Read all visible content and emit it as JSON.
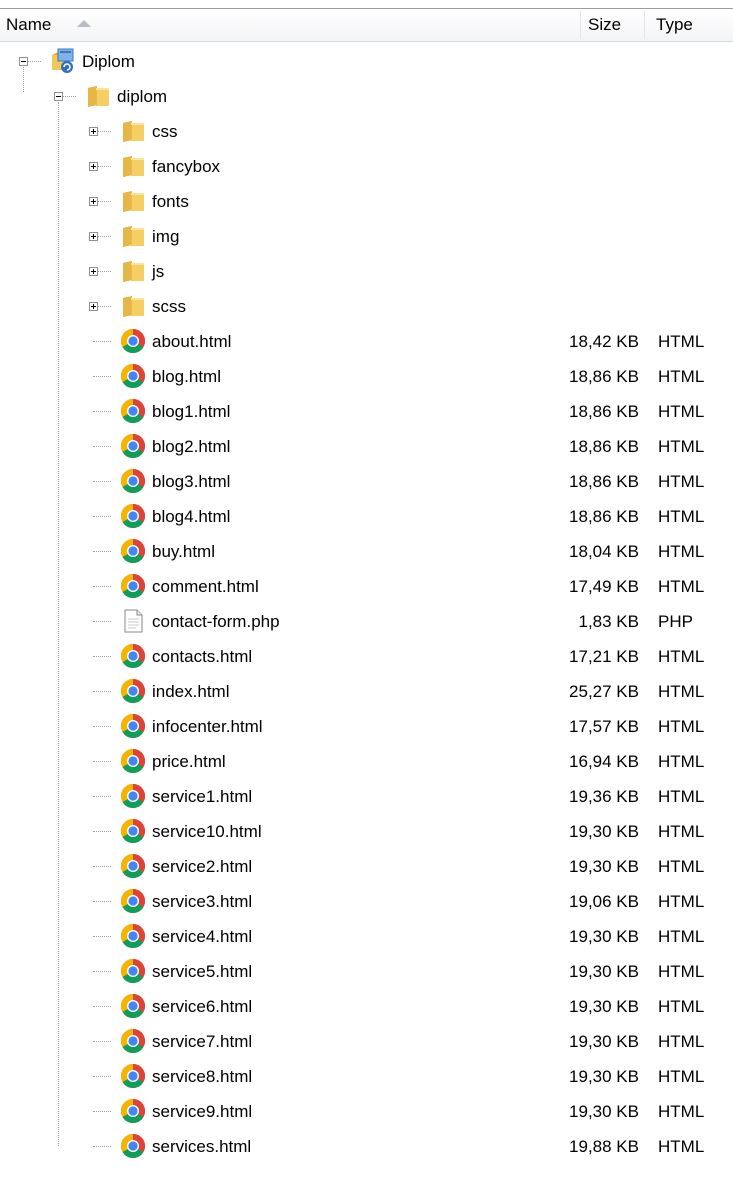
{
  "header": {
    "name_label": "Name",
    "size_label": "Size",
    "type_label": "Type"
  },
  "tree": {
    "root": {
      "label": "Diplom",
      "icon": "project-icon"
    },
    "folder": {
      "label": "diplom",
      "icon": "folder-icon"
    },
    "subfolders": [
      {
        "label": "css",
        "icon": "folder-icon"
      },
      {
        "label": "fancybox",
        "icon": "folder-icon"
      },
      {
        "label": "fonts",
        "icon": "folder-icon"
      },
      {
        "label": "img",
        "icon": "folder-icon"
      },
      {
        "label": "js",
        "icon": "folder-icon"
      },
      {
        "label": "scss",
        "icon": "folder-icon"
      }
    ],
    "files": [
      {
        "name": "about.html",
        "size": "18,42 KB",
        "type": "HTML",
        "icon": "chrome-icon"
      },
      {
        "name": "blog.html",
        "size": "18,86 KB",
        "type": "HTML",
        "icon": "chrome-icon"
      },
      {
        "name": "blog1.html",
        "size": "18,86 KB",
        "type": "HTML",
        "icon": "chrome-icon"
      },
      {
        "name": "blog2.html",
        "size": "18,86 KB",
        "type": "HTML",
        "icon": "chrome-icon"
      },
      {
        "name": "blog3.html",
        "size": "18,86 KB",
        "type": "HTML",
        "icon": "chrome-icon"
      },
      {
        "name": "blog4.html",
        "size": "18,86 KB",
        "type": "HTML",
        "icon": "chrome-icon"
      },
      {
        "name": "buy.html",
        "size": "18,04 KB",
        "type": "HTML",
        "icon": "chrome-icon"
      },
      {
        "name": "comment.html",
        "size": "17,49 KB",
        "type": "HTML",
        "icon": "chrome-icon"
      },
      {
        "name": "contact-form.php",
        "size": "1,83 KB",
        "type": "PHP",
        "icon": "document-icon"
      },
      {
        "name": "contacts.html",
        "size": "17,21 KB",
        "type": "HTML",
        "icon": "chrome-icon"
      },
      {
        "name": "index.html",
        "size": "25,27 KB",
        "type": "HTML",
        "icon": "chrome-icon"
      },
      {
        "name": "infocenter.html",
        "size": "17,57 KB",
        "type": "HTML",
        "icon": "chrome-icon"
      },
      {
        "name": "price.html",
        "size": "16,94 KB",
        "type": "HTML",
        "icon": "chrome-icon"
      },
      {
        "name": "service1.html",
        "size": "19,36 KB",
        "type": "HTML",
        "icon": "chrome-icon"
      },
      {
        "name": "service10.html",
        "size": "19,30 KB",
        "type": "HTML",
        "icon": "chrome-icon"
      },
      {
        "name": "service2.html",
        "size": "19,30 KB",
        "type": "HTML",
        "icon": "chrome-icon"
      },
      {
        "name": "service3.html",
        "size": "19,06 KB",
        "type": "HTML",
        "icon": "chrome-icon"
      },
      {
        "name": "service4.html",
        "size": "19,30 KB",
        "type": "HTML",
        "icon": "chrome-icon"
      },
      {
        "name": "service5.html",
        "size": "19,30 KB",
        "type": "HTML",
        "icon": "chrome-icon"
      },
      {
        "name": "service6.html",
        "size": "19,30 KB",
        "type": "HTML",
        "icon": "chrome-icon"
      },
      {
        "name": "service7.html",
        "size": "19,30 KB",
        "type": "HTML",
        "icon": "chrome-icon"
      },
      {
        "name": "service8.html",
        "size": "19,30 KB",
        "type": "HTML",
        "icon": "chrome-icon"
      },
      {
        "name": "service9.html",
        "size": "19,30 KB",
        "type": "HTML",
        "icon": "chrome-icon"
      },
      {
        "name": "services.html",
        "size": "19,88 KB",
        "type": "HTML",
        "icon": "chrome-icon"
      }
    ]
  }
}
